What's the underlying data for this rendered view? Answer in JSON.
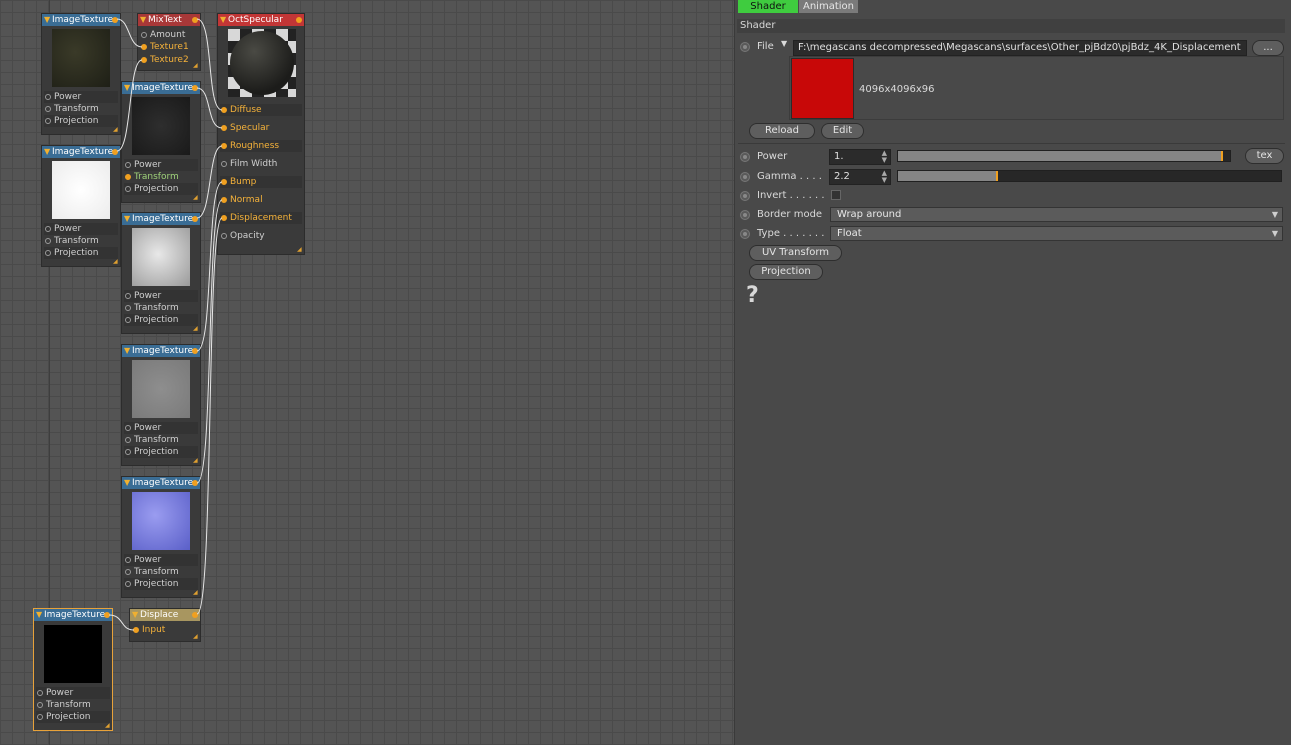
{
  "graph": {
    "nodes": {
      "tex1": {
        "title": "ImageTexture",
        "params": [
          "Power",
          "Transform",
          "Projection"
        ]
      },
      "mix": {
        "title": "MixText",
        "params": [
          "Amount",
          "Texture1",
          "Texture2"
        ]
      },
      "spec": {
        "title": "OctSpecular",
        "params": [
          "Diffuse",
          "Specular",
          "Roughness",
          "Film Width",
          "Bump",
          "Normal",
          "Displacement",
          "Opacity"
        ]
      },
      "tex2": {
        "title": "ImageTexture",
        "params": [
          "Power",
          "Transform",
          "Projection"
        ]
      },
      "tex3": {
        "title": "ImageTexture",
        "params": [
          "Power",
          "Transform",
          "Projection"
        ]
      },
      "tex4": {
        "title": "ImageTexture",
        "params": [
          "Power",
          "Transform",
          "Projection"
        ]
      },
      "tex5": {
        "title": "ImageTexture",
        "params": [
          "Power",
          "Transform",
          "Projection"
        ]
      },
      "tex6": {
        "title": "ImageTexture",
        "params": [
          "Power",
          "Transform",
          "Projection"
        ]
      },
      "displace": {
        "title": "Displace",
        "params": [
          "Input"
        ]
      },
      "tex7": {
        "title": "ImageTexture",
        "params": [
          "Power",
          "Transform",
          "Projection"
        ]
      }
    }
  },
  "panel": {
    "tabs": [
      "Shader",
      "Animation"
    ],
    "section": "Shader",
    "file_label": "File",
    "file_path": "F:\\megascans decompressed\\Megascans\\surfaces\\Other_pjBdz0\\pjBdz_4K_Displacement",
    "browse_label": "...",
    "resolution": "4096x4096x96",
    "reload_label": "Reload",
    "edit_label": "Edit",
    "power": {
      "label": "Power",
      "value": "1.",
      "level": 0.98,
      "tex_label": "tex"
    },
    "gamma": {
      "label": "Gamma . . . .",
      "value": "2.2",
      "level": 0.26
    },
    "invert_label": "Invert . . . . . .",
    "border_mode": {
      "label": "Border mode",
      "value": "Wrap around"
    },
    "type": {
      "label": "Type . . . . . . .",
      "value": "Float"
    },
    "uv_transform_label": "UV Transform",
    "projection_label": "Projection",
    "help_label": "?"
  },
  "colors": {
    "active_tab": "#3fcc3f",
    "node_texture": "#3a6d95",
    "node_mix": "#a83838",
    "node_specular": "#c23636",
    "node_displace": "#a89660",
    "accent": "#f0a020",
    "preview": "#c80808"
  }
}
